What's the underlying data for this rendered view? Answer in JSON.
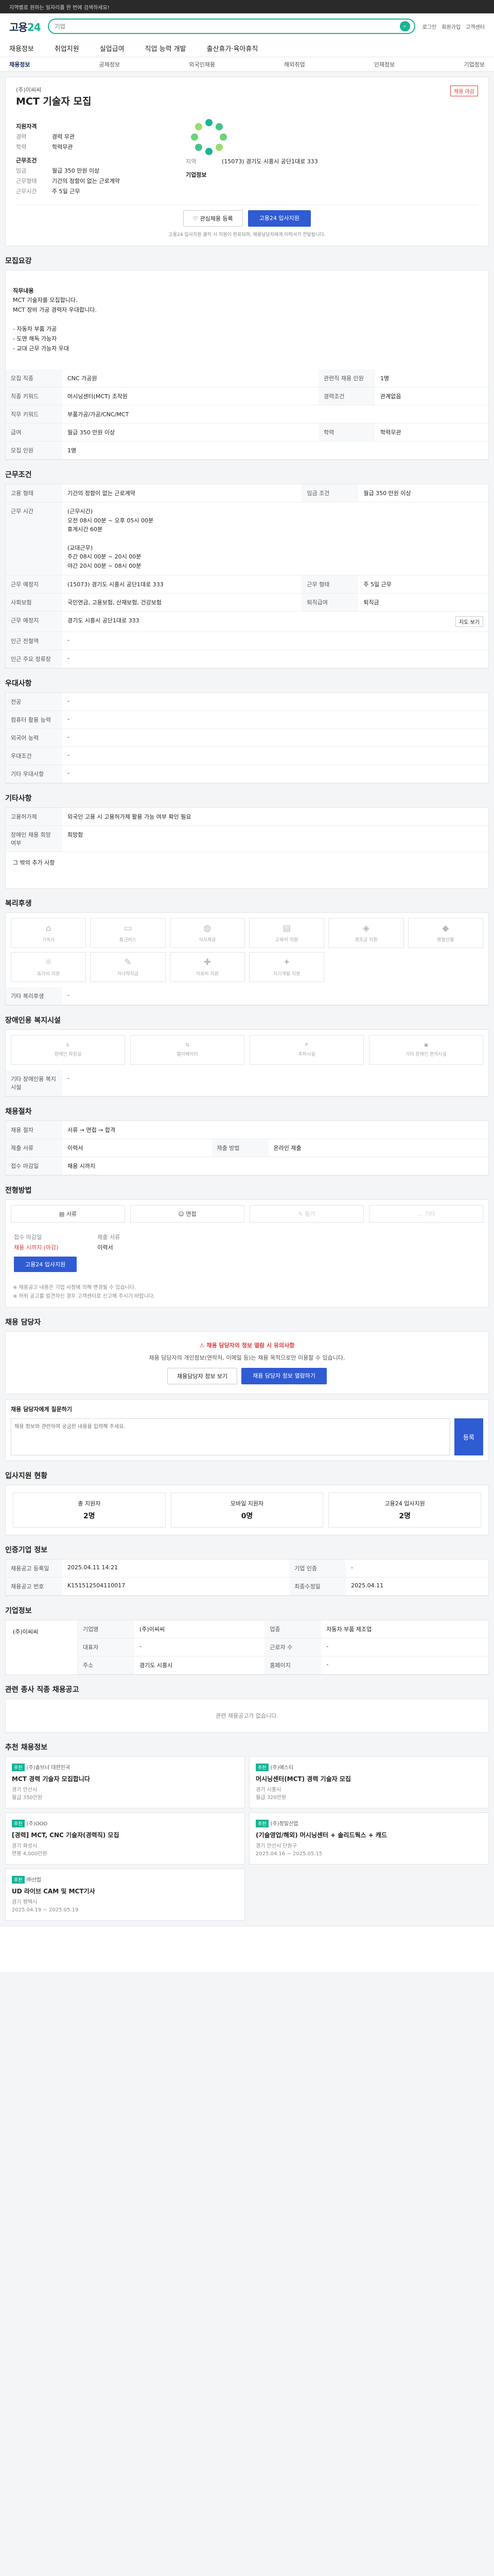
{
  "topbar": {
    "text": "지역별로 원하는 일자리를 한 번에 검색하세요!"
  },
  "header": {
    "logo_main": "고용",
    "logo_accent": "24",
    "search_placeholder": "기업",
    "links": [
      "로그인",
      "회원가입",
      "고객센터"
    ]
  },
  "gnb": [
    "채용정보",
    "취업지원",
    "실업급여",
    "직업 능력 개발",
    "출산휴가·육아휴직"
  ],
  "subnav": [
    "채용정보",
    "공채정보",
    "외국인채용",
    "해외취업",
    "인재정보",
    "기업정보"
  ],
  "hero": {
    "company": "(주)이씨씨",
    "badge": "채용 마감",
    "title": "MCT 기술자 모집",
    "basic_label": "지원자격",
    "career_k": "경력",
    "career_v": "경력 무관",
    "edu_k": "학력",
    "edu_v": "학력무관",
    "cond_label": "근무조건",
    "region_k": "지역",
    "region_v": "(15073) 경기도 시흥시 공단1대로 333",
    "pay_k": "임금",
    "pay_v": "월급 350 만원 이상",
    "type_k": "근무형태",
    "type_v": "기간의 정함이 없는 근로계약",
    "hours_k": "근무시간",
    "hours_v": "주 5일 근무",
    "company_label": "기업정보",
    "btn_interest": "관심채용 등록",
    "btn_apply": "고용24 입사지원",
    "notice": "고용24 입사지원 클릭 시 지원이 완료되며, 채용담당자에게 이력서가 전달됩니다."
  },
  "recruit": {
    "title": "모집요강",
    "job_label": "직무내용",
    "job_text": "MCT 기술자를 모집합니다.\nMCT 장비 가공 경력자 우대합니다.\n\n- 자동차 부품 가공\n- 도면 해독 가능자\n- 교대 근무 가능자 우대",
    "rows": [
      {
        "k": "모집 직종",
        "v": "CNC 가공원",
        "k2": "관련직 채용 인원",
        "v2": "1명"
      },
      {
        "k": "직종 키워드",
        "v": "머시닝센터(MCT) 조작원",
        "k2": "경력조건",
        "v2": "관계없음"
      },
      {
        "k": "직무 키워드",
        "v": "부품가공/가공/CNC/MCT",
        "k2": "",
        "v2": ""
      },
      {
        "k": "급여",
        "v": "월급 350 만원 이상",
        "k2": "학력",
        "v2": "학력무관"
      },
      {
        "k": "모집 인원",
        "v": "1명",
        "k2": "",
        "v2": ""
      }
    ]
  },
  "work": {
    "title": "근무조건",
    "rows": [
      {
        "k": "고용 형태",
        "v": "기간의 정함이 없는 근로계약",
        "k2": "임금 조건",
        "v2": "월급 350 만원 이상"
      },
      {
        "k": "근무 시간",
        "v": "(근무시간)\n오전 08시 00분 ~ 오후 05시 00분\n휴게시간 60분\n\n(교대근무)\n주간 08시 00분 ~ 20시 00분\n야간 20시 00분 ~ 08시 00분",
        "k2": "",
        "v2": ""
      },
      {
        "k": "근무 예정지",
        "v": "(15073) 경기도 시흥시 공단1대로 333",
        "k2": "근무 형태",
        "v2": "주 5일 근무"
      },
      {
        "k": "사회보험",
        "v": "국민연금, 고용보험, 산재보험, 건강보험",
        "k2": "퇴직급여",
        "v2": "퇴직금"
      },
      {
        "k": "근무 예정지",
        "v": "경기도 시흥시 공단1대로 333",
        "k2": "",
        "v2": ""
      },
      {
        "k": "인근 전철역",
        "v": "-",
        "k2": "",
        "v2": ""
      },
      {
        "k": "인근 주요 정류장",
        "v": "-",
        "k2": "",
        "v2": ""
      }
    ],
    "map_btn": "지도 보기"
  },
  "prefer": {
    "title": "우대사항",
    "rows": [
      {
        "k": "전공",
        "v": "-"
      },
      {
        "k": "컴퓨터 활용 능력",
        "v": "-"
      },
      {
        "k": "외국어 능력",
        "v": "-"
      },
      {
        "k": "우대조건",
        "v": "-"
      },
      {
        "k": "기타 우대사항",
        "v": "-"
      }
    ]
  },
  "etc": {
    "title": "기타사항",
    "rows": [
      {
        "k": "고용허가제",
        "v": "외국인 고용 시 고용허가제 활용 가능 여부 확인 필요"
      },
      {
        "k": "장애인 채용 희망 여부",
        "v": "희망함"
      }
    ],
    "extra": "그 밖의 추가 사항"
  },
  "welfare": {
    "title": "복리후생",
    "items": [
      "기숙사",
      "통근버스",
      "식사제공",
      "교육비 지원",
      "경조금 지원",
      "명절선물",
      "휴가비 지원",
      "자녀학자금",
      "의료비 지원",
      "자기계발 지원"
    ],
    "other_label": "기타 복리후생",
    "other_value": "-"
  },
  "conv": {
    "title": "장애인용 복지시설",
    "items": [
      "장애인 화장실",
      "엘리베이터",
      "주차시설",
      "기타 장애인 편의시설"
    ],
    "other_label": "기타 장애인용 복지시설",
    "other_value": "-"
  },
  "steps": {
    "title": "채용절차",
    "rows": [
      {
        "k": "채용 절차",
        "v": "서류 → 면접 → 합격",
        "k2": "",
        "v2": ""
      },
      {
        "k": "제출 서류",
        "v": "이력서",
        "k2": "제출 방법",
        "v2": "온라인 제출"
      },
      {
        "k": "접수 마감일",
        "v": "채용 시까지",
        "k2": "",
        "v2": ""
      }
    ]
  },
  "apply": {
    "title": "전형방법",
    "methods": [
      "서류",
      "면접",
      "필기",
      "기타"
    ],
    "deadline_label": "접수 마감일",
    "deadline_value": "채용 시까지 (마감)",
    "doc_label": "제출 서류",
    "doc_value": "이력서",
    "btn": "고용24 입사지원",
    "notes": "※ 채용공고 내용은 기업 사정에 의해 변경될 수 있습니다.\n※ 허위 공고를 발견하신 경우 고객센터로 신고해 주시기 바랍니다."
  },
  "manager": {
    "title": "채용 담당자",
    "warn": "채용 담당자의 정보 열람 시 유의사항",
    "text": "채용 담당자의 개인정보(연락처, 이메일 등)는 채용 목적으로만 이용할 수 있습니다.",
    "btn1": "채용담당자 정보 보기",
    "btn2": "채용 담당자 정보 열람하기"
  },
  "qa": {
    "title": "채용 담당자에게 질문하기",
    "placeholder": "채용 정보와 관련하여 궁금한 내용을 입력해 주세요.",
    "btn": "등록"
  },
  "stats": {
    "title": "입사지원 현황",
    "items": [
      {
        "label": "총 지원자",
        "value": "2명"
      },
      {
        "label": "모바일 지원자",
        "value": "0명"
      },
      {
        "label": "고용24 입사지원",
        "value": "2명"
      }
    ]
  },
  "info": {
    "title": "인증기업 정보",
    "rows": [
      {
        "k": "채용공고 등록일",
        "v": "2025.04.11 14:21",
        "k2": "기업 인증",
        "v2": "-"
      },
      {
        "k": "채용공고 번호",
        "v": "K151512504110017",
        "k2": "최종수정일",
        "v2": "2025.04.11"
      }
    ]
  },
  "company": {
    "title": "기업정보",
    "name": "(주)이씨씨",
    "rows": [
      {
        "k": "기업명",
        "v": "(주)이씨씨",
        "k2": "업종",
        "v2": "자동차 부품 제조업"
      },
      {
        "k": "대표자",
        "v": "-",
        "k2": "근로자 수",
        "v2": "-"
      },
      {
        "k": "주소",
        "v": "경기도 시흥시",
        "k2": "홈페이지",
        "v2": "-"
      }
    ]
  },
  "similar": {
    "title": "관련 종사 직종 채용공고",
    "empty": "관련 채용공고가 없습니다."
  },
  "ads": {
    "title": "추천 채용정보",
    "items": [
      {
        "tag": "추천",
        "co": "(주)솔브너 대한민국",
        "title": "MCT 경력 기술자 모집합니다",
        "meta": "경기 안산시\n월급 350만원"
      },
      {
        "tag": "추천",
        "co": "(주)에스티",
        "title": "머시닝센터(MCT) 경력 기술자 모집",
        "meta": "경기 시흥시\n월급 320만원"
      },
      {
        "tag": "추천",
        "co": "(주)OOO",
        "title": "[경력] MCT, CNC 기술자(경력직) 모집",
        "meta": "경기 화성시\n연봉 4,000만원"
      },
      {
        "tag": "추천",
        "co": "(주)정밀산업",
        "title": "(기술영업/해외) 머시닝센터 + 솔리드웍스 + 캐드",
        "meta": "경기 안산시 단원구\n2025.04.16 ~ 2025.05.15"
      },
      {
        "tag": "추천",
        "co": "㈜산업",
        "title": "UD 라이브 CAM 및 MCT기사",
        "meta": "경기 평택시\n2025.04.19 ~ 2025.05.19"
      }
    ]
  }
}
